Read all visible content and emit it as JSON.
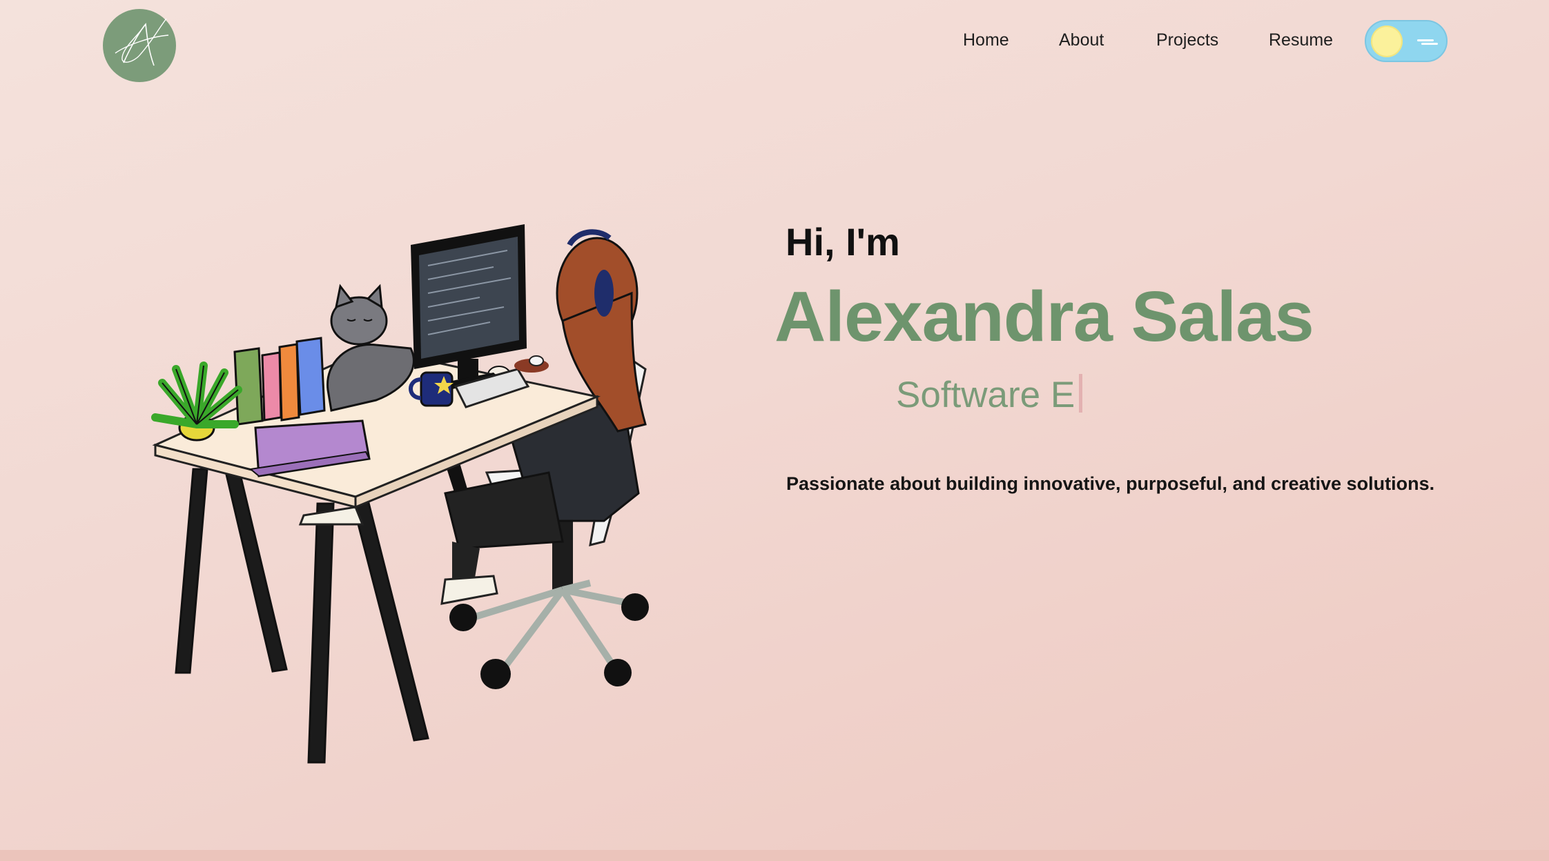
{
  "nav": {
    "links": [
      "Home",
      "About",
      "Projects",
      "Resume"
    ]
  },
  "theme_toggle": {
    "state": "light",
    "icon": "sun-icon"
  },
  "hero": {
    "greeting": "Hi, I'm",
    "name": "Alexandra Salas",
    "role_typed": "Software E",
    "tagline": "Passionate about building innovative, purposeful, and creative solutions."
  },
  "colors": {
    "accent_green": "#6e946d",
    "background": "#f2d8d2",
    "toggle_bg": "#8fd6ef",
    "sun": "#fbf19b"
  }
}
